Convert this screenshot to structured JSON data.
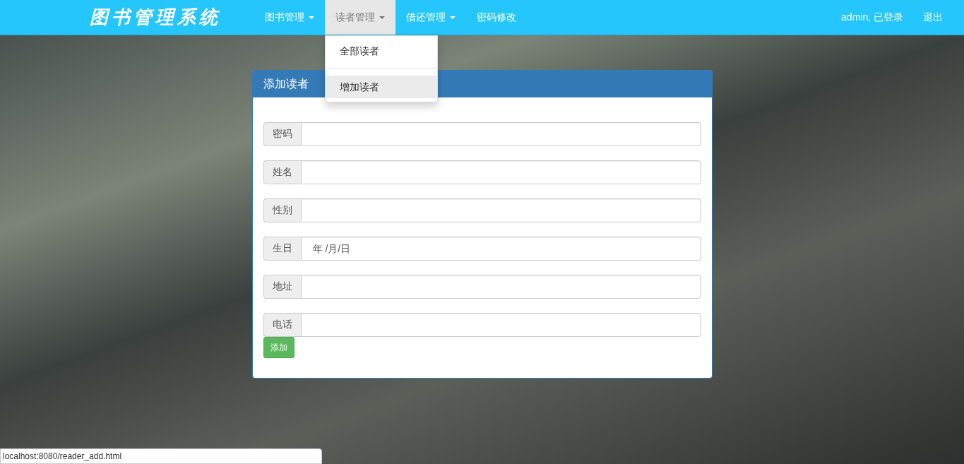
{
  "navbar": {
    "brand": "图书管理系统",
    "menus": [
      {
        "label": "图书管理",
        "dropdown": true,
        "selected": false
      },
      {
        "label": "读者管理",
        "dropdown": true,
        "selected": true
      },
      {
        "label": "借还管理",
        "dropdown": true,
        "selected": false
      },
      {
        "label": "密码修改",
        "dropdown": false,
        "selected": false
      }
    ],
    "user_status": "admin, 已登录",
    "logout": "退出"
  },
  "open_dropdown": {
    "items": [
      {
        "label": "全部读者",
        "selected": false
      },
      {
        "label": "增加读者",
        "selected": true
      }
    ]
  },
  "panel": {
    "title": "添加读者",
    "fields": [
      {
        "label": "密码",
        "kind": "text"
      },
      {
        "label": "姓名",
        "kind": "text"
      },
      {
        "label": "性别",
        "kind": "text"
      },
      {
        "label": "生日",
        "kind": "date",
        "placeholder": "年 /月/日"
      },
      {
        "label": "地址",
        "kind": "text"
      },
      {
        "label": "电话",
        "kind": "text"
      }
    ],
    "submit": "添加"
  },
  "status_bar": {
    "url": "localhost:8080/reader_add.html"
  }
}
